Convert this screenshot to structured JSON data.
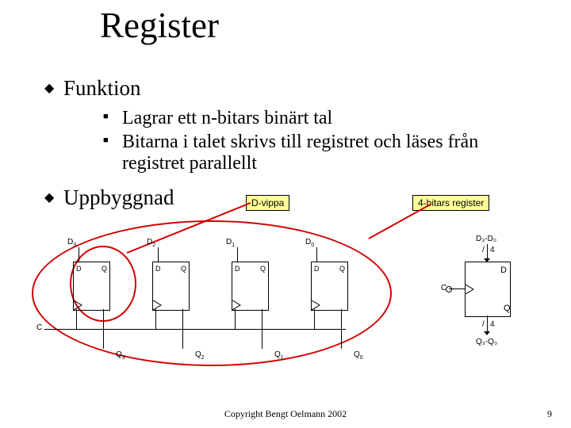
{
  "title": "Register",
  "bullets": {
    "funktion": "Funktion",
    "sub1": "Lagrar ett n-bitars binärt tal",
    "sub2": "Bitarna i talet skrivs till registret och läses från registret parallellt",
    "uppbyggnad": "Uppbyggnad"
  },
  "annot": {
    "dvippa": "D-vippa",
    "reg4": "4-bitars register"
  },
  "ff_labels": {
    "d": "D",
    "q": "Q"
  },
  "clk_label": "C",
  "top_inputs": {
    "d3": "D",
    "d2": "D",
    "d1": "D",
    "d0": "D"
  },
  "top_sub": {
    "d3": "3",
    "d2": "2",
    "d1": "1",
    "d0": "0"
  },
  "bot_outputs": {
    "q3": "Q",
    "q2": "Q",
    "q1": "Q",
    "q0": "Q"
  },
  "bot_sub": {
    "q3": "3",
    "q2": "2",
    "q1": "1",
    "q0": "0"
  },
  "reg_block": {
    "bus_top": "D₃-D₀",
    "bus_top_width": "4",
    "pin_d": "D",
    "pin_q": "Q",
    "pin_c": "C",
    "bus_bot": "Q₃-Q₀",
    "bus_bot_width": "4"
  },
  "footer": "Copyright Bengt Oelmann 2002",
  "page": "9"
}
